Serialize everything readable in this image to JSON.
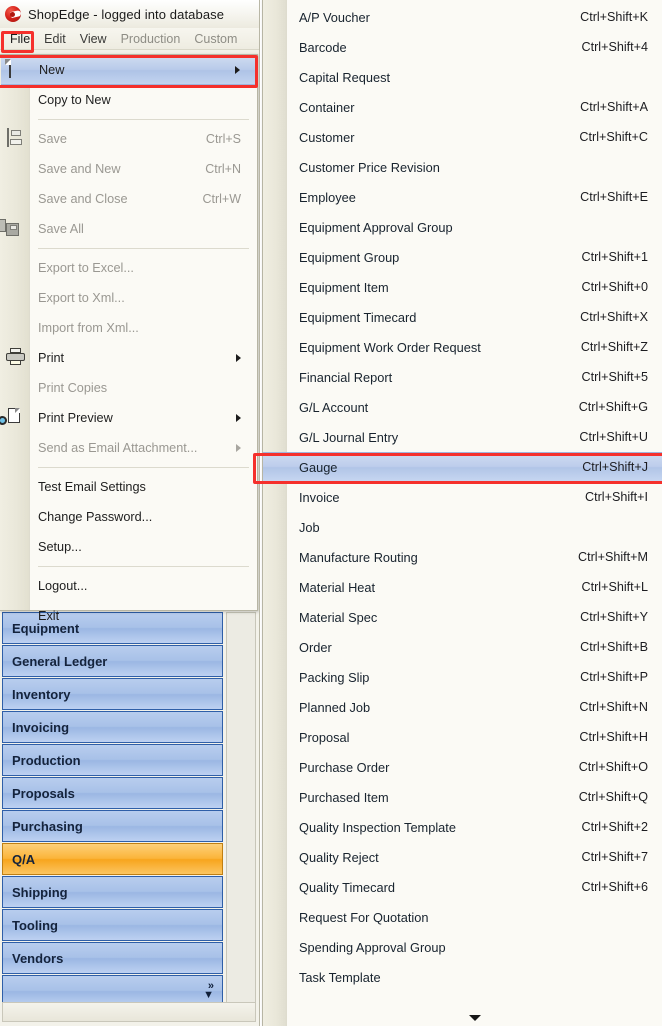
{
  "window": {
    "title": "ShopEdge -  logged into database",
    "logo_icon": "shopedge-logo-icon"
  },
  "menubar": {
    "items": [
      {
        "label": "File",
        "active": true
      },
      {
        "label": "Edit",
        "active": false
      },
      {
        "label": "View",
        "active": false
      },
      {
        "label": "Production",
        "active": false
      },
      {
        "label": "Custom",
        "active": false
      }
    ]
  },
  "file_menu": {
    "groups": [
      [
        {
          "label": "New",
          "accel": "",
          "icon": "new-document-icon",
          "submenu": true,
          "selected": true,
          "disabled": false
        },
        {
          "label": "Copy to New",
          "accel": "",
          "icon": "",
          "submenu": false,
          "selected": false,
          "disabled": false
        }
      ],
      [
        {
          "label": "Save",
          "accel": "Ctrl+S",
          "icon": "floppy-disk-icon",
          "submenu": false,
          "selected": false,
          "disabled": true
        },
        {
          "label": "Save and New",
          "accel": "Ctrl+N",
          "icon": "",
          "submenu": false,
          "selected": false,
          "disabled": true
        },
        {
          "label": "Save and Close",
          "accel": "Ctrl+W",
          "icon": "",
          "submenu": false,
          "selected": false,
          "disabled": true
        },
        {
          "label": "Save All",
          "accel": "",
          "icon": "save-all-icon",
          "submenu": false,
          "selected": false,
          "disabled": true
        }
      ],
      [
        {
          "label": "Export to Excel...",
          "accel": "",
          "icon": "",
          "submenu": false,
          "selected": false,
          "disabled": true
        },
        {
          "label": "Export to Xml...",
          "accel": "",
          "icon": "",
          "submenu": false,
          "selected": false,
          "disabled": true
        },
        {
          "label": "Import from Xml...",
          "accel": "",
          "icon": "",
          "submenu": false,
          "selected": false,
          "disabled": true
        },
        {
          "label": "Print",
          "accel": "",
          "icon": "printer-icon",
          "submenu": true,
          "selected": false,
          "disabled": false
        },
        {
          "label": "Print Copies",
          "accel": "",
          "icon": "",
          "submenu": false,
          "selected": false,
          "disabled": true
        },
        {
          "label": "Print Preview",
          "accel": "",
          "icon": "print-preview-icon",
          "submenu": true,
          "selected": false,
          "disabled": false
        },
        {
          "label": "Send as Email Attachment...",
          "accel": "",
          "icon": "",
          "submenu": true,
          "selected": false,
          "disabled": true
        }
      ],
      [
        {
          "label": "Test Email Settings",
          "accel": "",
          "icon": "",
          "submenu": false,
          "selected": false,
          "disabled": false
        },
        {
          "label": "Change Password...",
          "accel": "",
          "icon": "",
          "submenu": false,
          "selected": false,
          "disabled": false
        },
        {
          "label": "Setup...",
          "accel": "",
          "icon": "",
          "submenu": false,
          "selected": false,
          "disabled": false
        }
      ],
      [
        {
          "label": "Logout...",
          "accel": "",
          "icon": "",
          "submenu": false,
          "selected": false,
          "disabled": false
        },
        {
          "label": "Exit",
          "accel": "",
          "icon": "",
          "submenu": false,
          "selected": false,
          "disabled": false
        }
      ]
    ]
  },
  "new_submenu": {
    "items": [
      {
        "label": "A/P Voucher",
        "accel": "Ctrl+Shift+K",
        "selected": false
      },
      {
        "label": "Barcode",
        "accel": "Ctrl+Shift+4",
        "selected": false
      },
      {
        "label": "Capital Request",
        "accel": "",
        "selected": false
      },
      {
        "label": "Container",
        "accel": "Ctrl+Shift+A",
        "selected": false
      },
      {
        "label": "Customer",
        "accel": "Ctrl+Shift+C",
        "selected": false
      },
      {
        "label": "Customer Price Revision",
        "accel": "",
        "selected": false
      },
      {
        "label": "Employee",
        "accel": "Ctrl+Shift+E",
        "selected": false
      },
      {
        "label": "Equipment Approval Group",
        "accel": "",
        "selected": false
      },
      {
        "label": "Equipment Group",
        "accel": "Ctrl+Shift+1",
        "selected": false
      },
      {
        "label": "Equipment Item",
        "accel": "Ctrl+Shift+0",
        "selected": false
      },
      {
        "label": "Equipment Timecard",
        "accel": "Ctrl+Shift+X",
        "selected": false
      },
      {
        "label": "Equipment Work Order Request",
        "accel": "Ctrl+Shift+Z",
        "selected": false
      },
      {
        "label": "Financial Report",
        "accel": "Ctrl+Shift+5",
        "selected": false
      },
      {
        "label": "G/L Account",
        "accel": "Ctrl+Shift+G",
        "selected": false
      },
      {
        "label": "G/L Journal Entry",
        "accel": "Ctrl+Shift+U",
        "selected": false
      },
      {
        "label": "Gauge",
        "accel": "Ctrl+Shift+J",
        "selected": true
      },
      {
        "label": "Invoice",
        "accel": "Ctrl+Shift+I",
        "selected": false
      },
      {
        "label": "Job",
        "accel": "",
        "selected": false
      },
      {
        "label": "Manufacture Routing",
        "accel": "Ctrl+Shift+M",
        "selected": false
      },
      {
        "label": "Material Heat",
        "accel": "Ctrl+Shift+L",
        "selected": false
      },
      {
        "label": "Material Spec",
        "accel": "Ctrl+Shift+Y",
        "selected": false
      },
      {
        "label": "Order",
        "accel": "Ctrl+Shift+B",
        "selected": false
      },
      {
        "label": "Packing Slip",
        "accel": "Ctrl+Shift+P",
        "selected": false
      },
      {
        "label": "Planned Job",
        "accel": "Ctrl+Shift+N",
        "selected": false
      },
      {
        "label": "Proposal",
        "accel": "Ctrl+Shift+H",
        "selected": false
      },
      {
        "label": "Purchase Order",
        "accel": "Ctrl+Shift+O",
        "selected": false
      },
      {
        "label": "Purchased Item",
        "accel": "Ctrl+Shift+Q",
        "selected": false
      },
      {
        "label": "Quality Inspection Template",
        "accel": "Ctrl+Shift+2",
        "selected": false
      },
      {
        "label": "Quality Reject",
        "accel": "Ctrl+Shift+7",
        "selected": false
      },
      {
        "label": "Quality Timecard",
        "accel": "Ctrl+Shift+6",
        "selected": false
      },
      {
        "label": "Request For Quotation",
        "accel": "",
        "selected": false
      },
      {
        "label": "Spending Approval Group",
        "accel": "",
        "selected": false
      },
      {
        "label": "Task Template",
        "accel": "",
        "selected": false
      }
    ],
    "scroll_down_icon": "chevron-down-icon"
  },
  "sidebar": {
    "items": [
      {
        "label": "Equipment",
        "active": false
      },
      {
        "label": "General Ledger",
        "active": false
      },
      {
        "label": "Inventory",
        "active": false
      },
      {
        "label": "Invoicing",
        "active": false
      },
      {
        "label": "Production",
        "active": false
      },
      {
        "label": "Proposals",
        "active": false
      },
      {
        "label": "Purchasing",
        "active": false
      },
      {
        "label": "Q/A",
        "active": true
      },
      {
        "label": "Shipping",
        "active": false
      },
      {
        "label": "Tooling",
        "active": false
      },
      {
        "label": "Vendors",
        "active": false
      }
    ],
    "overflow_label": "»",
    "overflow_caret": "▼"
  },
  "annotations": {
    "accent_color": "#f5302c",
    "boxes": [
      "file-menu-label",
      "new-menu-item",
      "gauge-submenu-item"
    ]
  }
}
